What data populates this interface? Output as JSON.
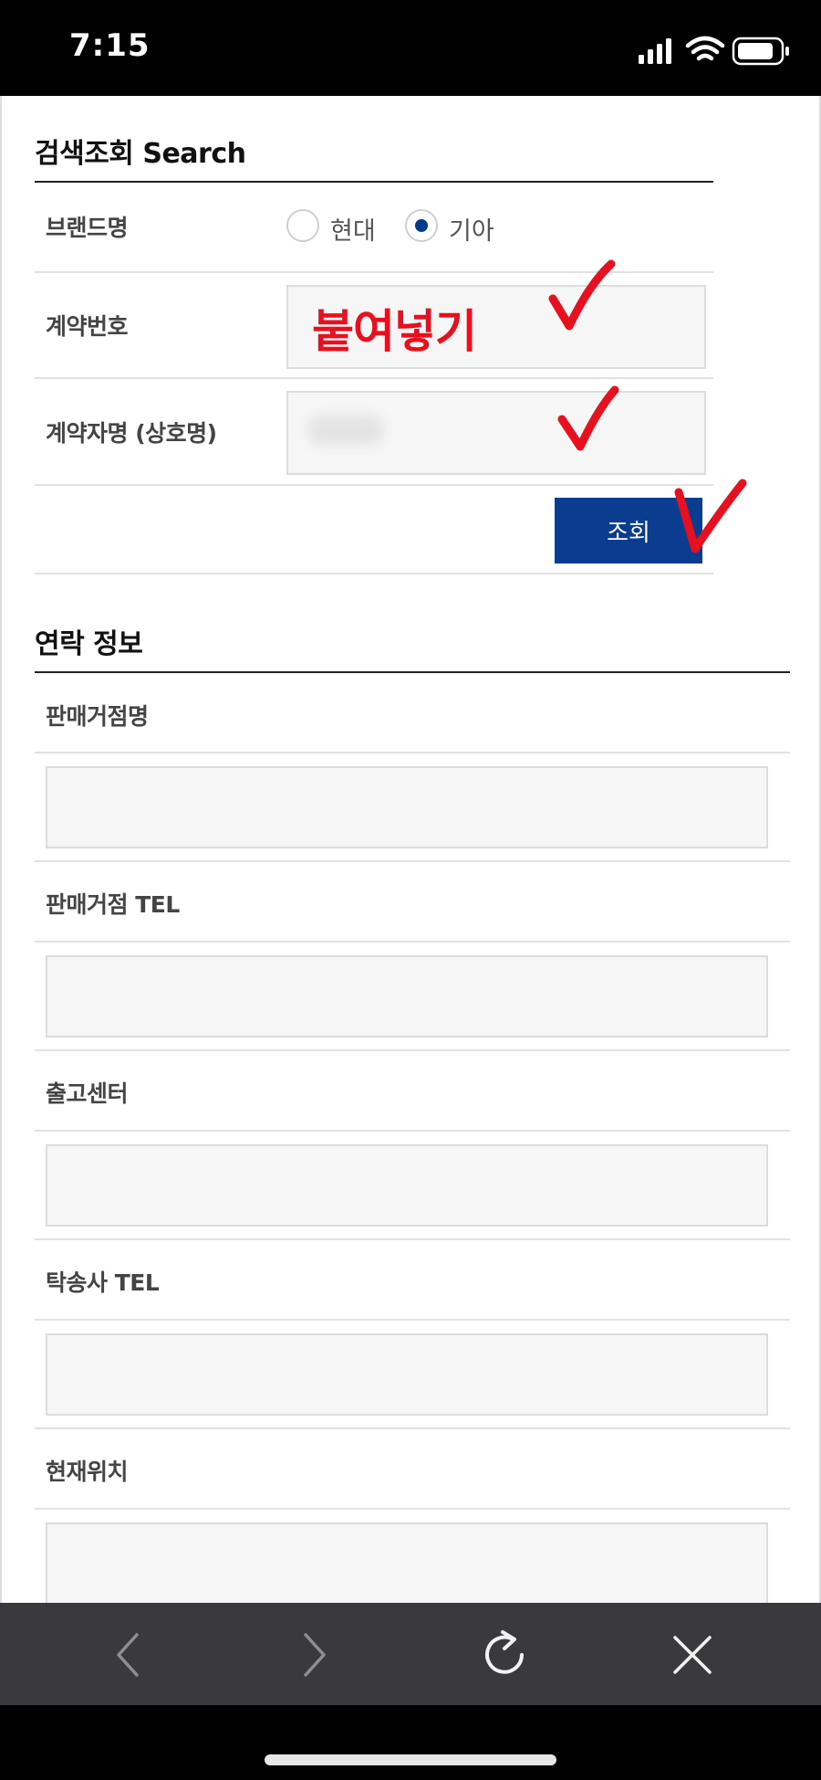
{
  "status_bar": {
    "time": "7:15"
  },
  "search_section": {
    "title": "검색조회 Search",
    "brand_label": "브랜드명",
    "brand_options": [
      {
        "label": "현대",
        "selected": false
      },
      {
        "label": "기아",
        "selected": true
      }
    ],
    "contract_number_label": "계약번호",
    "contract_number_overlay": "붙여넣기",
    "contractor_name_label": "계약자명 (상호명)",
    "search_button": "조회"
  },
  "contact_section": {
    "title": "연락 정보",
    "fields": [
      {
        "label": "판매거점명",
        "value": ""
      },
      {
        "label": "판매거점 TEL",
        "value": ""
      },
      {
        "label": "출고센터",
        "value": ""
      },
      {
        "label": "탁송사 TEL",
        "value": ""
      },
      {
        "label": "현재위치",
        "value": ""
      }
    ]
  },
  "toolbar": {
    "icons": [
      "back-icon",
      "forward-icon",
      "reload-icon",
      "close-icon"
    ]
  },
  "colors": {
    "accent": "#0a3d8f",
    "annotation": "#e8101f",
    "toolbar": "#3a3a3c"
  }
}
